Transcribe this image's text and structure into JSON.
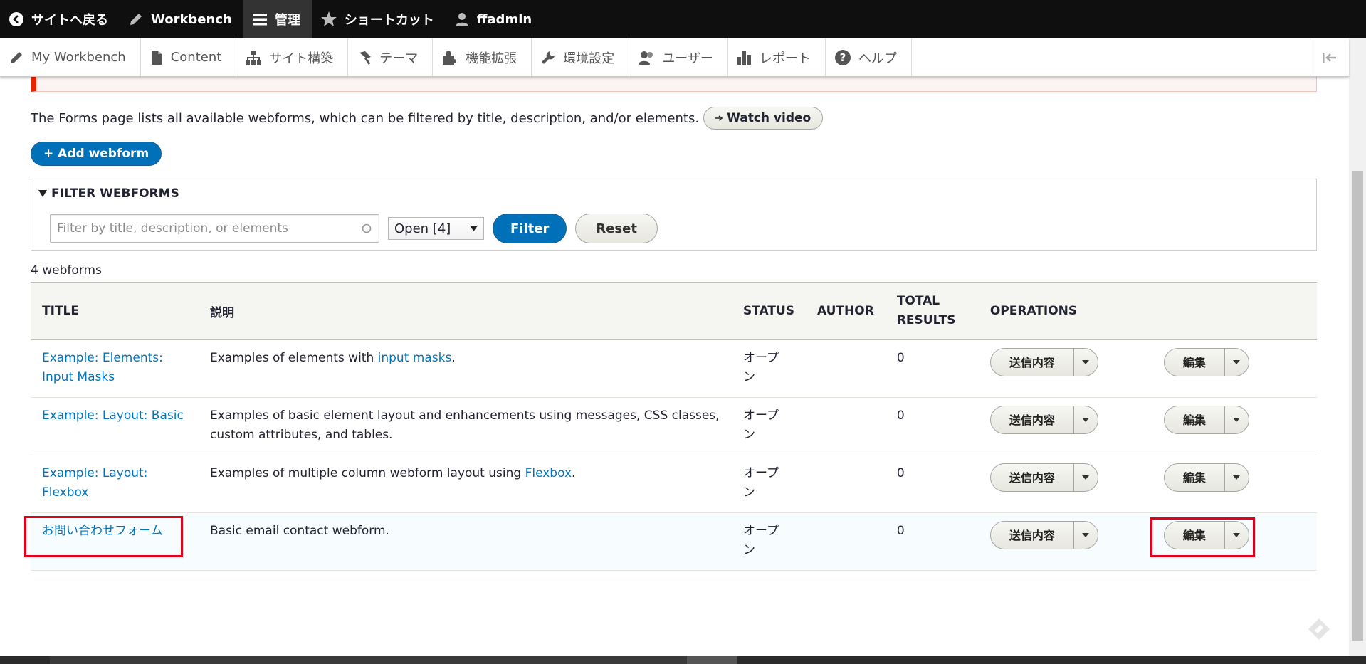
{
  "toolbar": {
    "back": "サイトへ戻る",
    "workbench": "Workbench",
    "manage": "管理",
    "shortcuts": "ショートカット",
    "user": "ffadmin"
  },
  "tray": {
    "items": [
      "My Workbench",
      "Content",
      "サイト構築",
      "テーマ",
      "機能拡張",
      "環境設定",
      "ユーザー",
      "レポート",
      "ヘルプ"
    ]
  },
  "intro": {
    "text": "The Forms page lists all available webforms, which can be filtered by title, description, and/or elements.",
    "watch_video": "Watch video"
  },
  "add_webform": "+ Add webform",
  "filter": {
    "legend": "FILTER WEBFORMS",
    "placeholder": "Filter by title, description, or elements",
    "state": "Open [4]",
    "filter_label": "Filter",
    "reset_label": "Reset"
  },
  "count": "4 webforms",
  "table": {
    "headers": {
      "title": "TITLE",
      "desc": "説明",
      "status": "STATUS",
      "author": "AUTHOR",
      "total": "TOTAL RESULTS",
      "ops": "OPERATIONS"
    },
    "rows": [
      {
        "title": "Example: Elements: Input Masks",
        "desc_pre": "Examples of elements with ",
        "desc_link": "input masks",
        "desc_post": ".",
        "status": "オープン",
        "total": "0",
        "op1": "送信内容",
        "op2": "編集"
      },
      {
        "title": "Example: Layout: Basic",
        "desc_pre": "Examples of basic element layout and enhancements using messages, CSS classes, custom attributes, and tables.",
        "desc_link": "",
        "desc_post": "",
        "status": "オープン",
        "total": "0",
        "op1": "送信内容",
        "op2": "編集"
      },
      {
        "title": "Example: Layout: Flexbox",
        "desc_pre": "Examples of multiple column webform layout using ",
        "desc_link": "Flexbox",
        "desc_post": ".",
        "status": "オープン",
        "total": "0",
        "op1": "送信内容",
        "op2": "編集"
      },
      {
        "title": "お問い合わせフォーム",
        "desc_pre": "Basic email contact webform.",
        "desc_link": "",
        "desc_post": "",
        "status": "オープン",
        "total": "0",
        "op1": "送信内容",
        "op2": "編集"
      }
    ]
  },
  "colors": {
    "toolbar_bg": "#0f0f0f",
    "primary_button": "#0071b8",
    "link": "#0074bd",
    "highlight_box": "#e3001b",
    "error_border": "#e62600"
  }
}
